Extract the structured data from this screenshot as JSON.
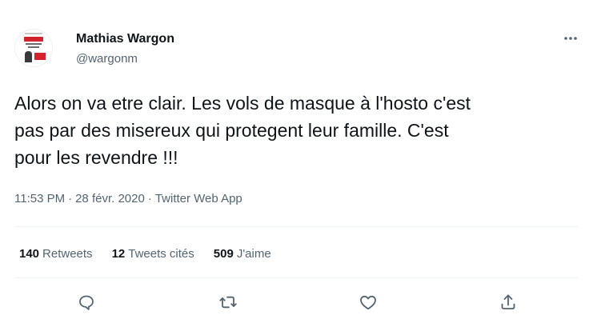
{
  "tweet": {
    "author": {
      "name": "Mathias Wargon",
      "handle": "@wargonm"
    },
    "text": "Alors on va etre clair. Les vols de masque à l'hosto c'est\npas par des misereux qui protegent leur famille. C'est\npour les revendre !!!",
    "time": "11:53 PM",
    "separator": "·",
    "date": "28 févr. 2020",
    "source": "Twitter Web App"
  },
  "stats": {
    "retweets": {
      "count": "140",
      "label": "Retweets"
    },
    "quotes": {
      "count": "12",
      "label": "Tweets cités"
    },
    "likes": {
      "count": "509",
      "label": "J'aime"
    }
  },
  "icons": {
    "more": "more-horizontal-icon",
    "reply": "reply-icon",
    "retweet": "retweet-icon",
    "like": "heart-icon",
    "share": "share-icon"
  },
  "colors": {
    "text": "#0f1419",
    "secondary": "#536471",
    "divider": "#eff3f4",
    "avatar_accent": "#d3232d"
  }
}
